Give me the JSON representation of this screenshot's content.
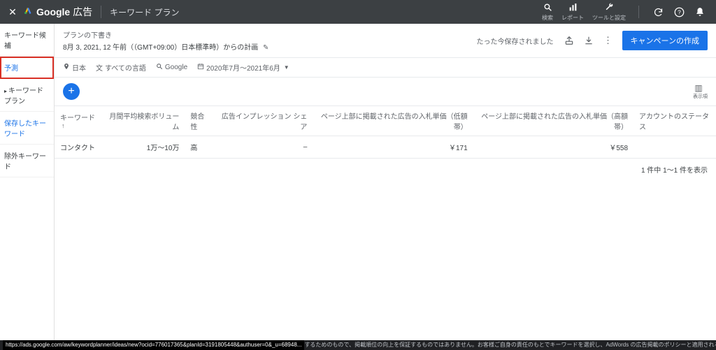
{
  "topbar": {
    "brand_bold": "Google",
    "brand_rest": " 広告",
    "page_title": "キーワード プラン",
    "tools": {
      "search": {
        "label": "検索"
      },
      "report": {
        "label": "レポート"
      },
      "tools": {
        "label": "ツールと設定"
      }
    }
  },
  "sidebar": {
    "items": [
      {
        "label": "キーワード候補"
      },
      {
        "label": "予測"
      },
      {
        "label": "キーワード プラン"
      },
      {
        "label": "保存したキーワード"
      },
      {
        "label": "除外キーワード"
      }
    ]
  },
  "plan": {
    "draft_label": "プランの下書き",
    "date_line": "8月 3, 2021, 12 午前（（GMT+09:00）日本標準時）からの計画",
    "saved_msg": "たった今保存されました",
    "create_btn": "キャンペーンの作成"
  },
  "filters": {
    "location": "日本",
    "language": "すべての言語",
    "network": "Google",
    "date_range": "2020年7月～2021年6月"
  },
  "toolbar": {
    "segment_label": "表示項"
  },
  "table": {
    "cols": {
      "keyword": "キーワード",
      "volume": "月間平均検索ボリューム",
      "competition": "競合性",
      "impr_share": "広告インプレッション シェア",
      "bid_low": "ページ上部に掲載された広告の入札単価（低額帯）",
      "bid_high": "ページ上部に掲載された広告の入札単価（高額帯）",
      "status": "アカウントのステータス"
    },
    "rows": [
      {
        "keyword": "コンタクト",
        "volume": "1万～10万",
        "competition": "高",
        "impr_share": "–",
        "bid_low": "￥171",
        "bid_high": "￥558",
        "status": ""
      }
    ],
    "footer": "1 件中 1～1 件を表示"
  },
  "statusbar": {
    "url": "https://ads.google.com/aw/keywordplanner/ideas/new?ocid=776017365&planId=3191805448&authuser=0&_u=68948...",
    "disclaimer": "するためのもので、掲載順位の向上を保証するものではありません。お客様ご自身の責任のもとでキーワードを選択し、AdWords の広告掲載のポリシーと適用される法律を遵守してください。"
  }
}
